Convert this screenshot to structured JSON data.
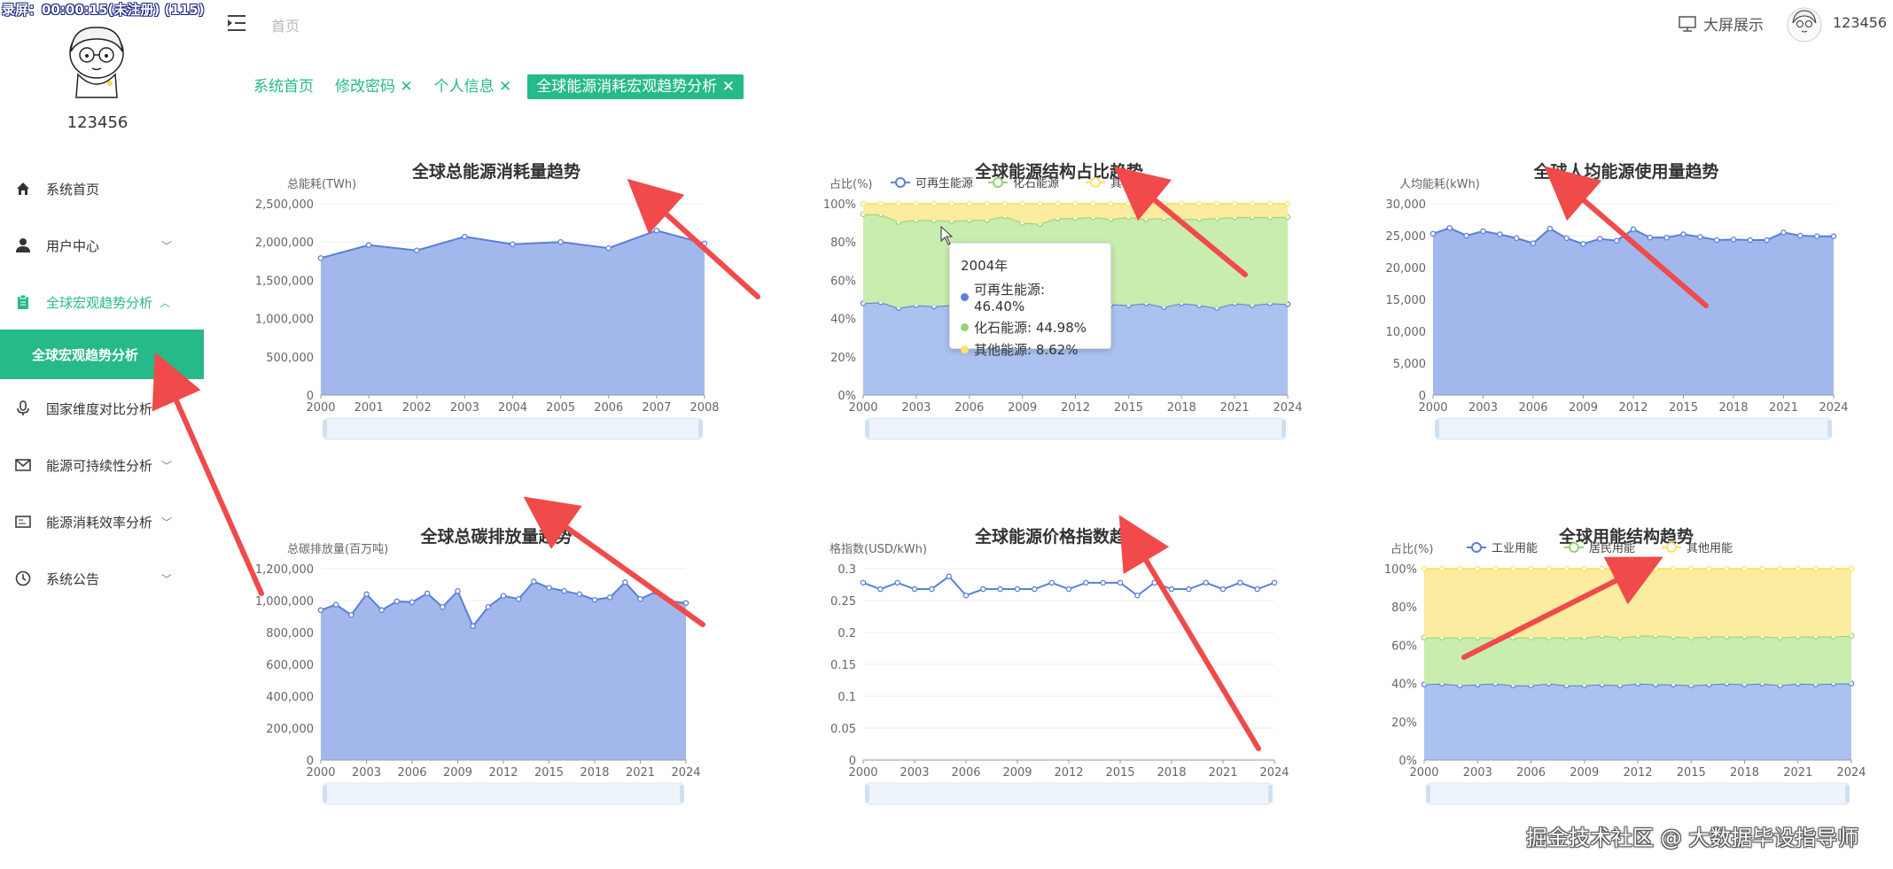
{
  "recording_overlay": "录屏：00:00:15(未注册) (115)",
  "sidebar": {
    "username": "123456",
    "items": [
      {
        "label": "系统首页",
        "icon": "home-icon"
      },
      {
        "label": "用户中心",
        "icon": "user-icon",
        "chevron": "﹀"
      },
      {
        "label": "全球宏观趋势分析",
        "icon": "clipboard-icon",
        "chevron": "︿",
        "open": true
      },
      {
        "label": "国家维度对比分析",
        "icon": "microphone-icon",
        "chevron": "﹀"
      },
      {
        "label": "能源可持续性分析",
        "icon": "mail-icon",
        "chevron": "﹀"
      },
      {
        "label": "能源消耗效率分析",
        "icon": "id-card-icon",
        "chevron": "﹀"
      },
      {
        "label": "系统公告",
        "icon": "clock-icon",
        "chevron": "﹀"
      }
    ],
    "submenu_active": "全球宏观趋势分析"
  },
  "topbar": {
    "breadcrumb": "首页",
    "big_screen_label": "大屏展示",
    "username": "123456"
  },
  "tabs": [
    {
      "label": "系统首页",
      "closable": false,
      "active": false
    },
    {
      "label": "修改密码",
      "closable": true,
      "active": false
    },
    {
      "label": "个人信息",
      "closable": true,
      "active": false
    },
    {
      "label": "全球能源消耗宏观趋势分析",
      "closable": true,
      "active": true
    }
  ],
  "colors": {
    "accent": "#26b98a",
    "blue": "#5b7fd8",
    "blue_fill": "#9db4ec",
    "green": "#95d475",
    "green_fill": "#c6ecaa",
    "yellow": "#fce36b",
    "yellow_fill": "#fbeb9a",
    "arrow": "#f04a4a"
  },
  "tooltip": {
    "title": "2004年",
    "rows": [
      {
        "label": "可再生能源: 46.40%",
        "color": "#5b7fd8"
      },
      {
        "label": "化石能源: 44.98%",
        "color": "#95d475"
      },
      {
        "label": "其他能源: 8.62%",
        "color": "#fce36b"
      }
    ]
  },
  "watermark": "掘金技术社区 @ 大数据毕设指导师",
  "chart_data": [
    {
      "id": "total",
      "type": "area",
      "title": "全球总能源消耗量趋势",
      "ylabel": "总能耗(TWh)",
      "ylim": [
        0,
        2500000
      ],
      "yticks": [
        "0",
        "500,000",
        "1,000,000",
        "1,500,000",
        "2,000,000",
        "2,500,000"
      ],
      "x": [
        2000,
        2001,
        2002,
        2003,
        2004,
        2005,
        2006,
        2007,
        2008
      ],
      "xticks": [
        "2000",
        "2001",
        "2002",
        "2003",
        "2004",
        "2005",
        "2006",
        "2007",
        "2008"
      ],
      "series": [
        {
          "values": [
            1790000,
            1960000,
            1890000,
            2070000,
            1970000,
            2000000,
            1920000,
            2150000,
            1980000
          ]
        }
      ]
    },
    {
      "id": "structure",
      "type": "area",
      "stacked": true,
      "title": "全球能源结构占比趋势",
      "ylabel": "占比(%)",
      "ylim": [
        0,
        100
      ],
      "yticks": [
        "0%",
        "20%",
        "40%",
        "60%",
        "80%",
        "100%"
      ],
      "legend": [
        "可再生能源",
        "化石能源",
        "其他能源"
      ],
      "x": [
        2000,
        2001,
        2002,
        2003,
        2004,
        2005,
        2006,
        2007,
        2008,
        2009,
        2010,
        2011,
        2012,
        2013,
        2014,
        2015,
        2016,
        2017,
        2018,
        2019,
        2020,
        2021,
        2022,
        2023,
        2024
      ],
      "xticks": [
        "2000",
        "2003",
        "2006",
        "2009",
        "2012",
        "2015",
        "2018",
        "2021",
        "2024"
      ],
      "series": [
        {
          "name": "可再生能源",
          "values": [
            48,
            48.5,
            45.5,
            47,
            46.4,
            47,
            45,
            47,
            46.5,
            48,
            45,
            47,
            46,
            48,
            47.5,
            47,
            48,
            46,
            48,
            47,
            45.5,
            48,
            47,
            48,
            47.5
          ]
        },
        {
          "name": "化石能源",
          "values": [
            46.5,
            46,
            45,
            44.5,
            44.98,
            44,
            46.5,
            44.5,
            47,
            42,
            44.5,
            45.5,
            46.5,
            45,
            44.5,
            46,
            44,
            46.5,
            44,
            45,
            47,
            45,
            46,
            45,
            45.5
          ]
        },
        {
          "name": "其他能源",
          "values": [
            5.5,
            5.5,
            9.5,
            8.5,
            8.62,
            9,
            8.5,
            8.5,
            6.5,
            10,
            10.5,
            7.5,
            7.5,
            7,
            8,
            7,
            8,
            7.5,
            8,
            8,
            7.5,
            7,
            7,
            7,
            7
          ]
        }
      ]
    },
    {
      "id": "percapita",
      "type": "area",
      "title": "全球人均能源使用量趋势",
      "ylabel": "人均能耗(kWh)",
      "ylim": [
        0,
        30000
      ],
      "yticks": [
        "0",
        "5,000",
        "10,000",
        "15,000",
        "20,000",
        "25,000",
        "30,000"
      ],
      "x": [
        2000,
        2001,
        2002,
        2003,
        2004,
        2005,
        2006,
        2007,
        2008,
        2009,
        2010,
        2011,
        2012,
        2013,
        2014,
        2015,
        2016,
        2017,
        2018,
        2019,
        2020,
        2021,
        2022,
        2023,
        2024
      ],
      "xticks": [
        "2000",
        "2003",
        "2006",
        "2009",
        "2012",
        "2015",
        "2018",
        "2021",
        "2024"
      ],
      "series": [
        {
          "values": [
            25300,
            26200,
            25000,
            25700,
            25200,
            24600,
            23800,
            26100,
            24600,
            23700,
            24500,
            24200,
            26000,
            24700,
            24700,
            25200,
            24800,
            24300,
            24400,
            24300,
            24300,
            25500,
            25000,
            24900,
            24900
          ]
        }
      ]
    },
    {
      "id": "carbon",
      "type": "area",
      "title": "全球总碳排放量趋势",
      "ylabel": "总碳排放量(百万吨)",
      "ylim": [
        0,
        1200000
      ],
      "yticks": [
        "0",
        "200,000",
        "400,000",
        "600,000",
        "800,000",
        "1,000,000",
        "1,200,000"
      ],
      "x": [
        2000,
        2001,
        2002,
        2003,
        2004,
        2005,
        2006,
        2007,
        2008,
        2009,
        2010,
        2011,
        2012,
        2013,
        2014,
        2015,
        2016,
        2017,
        2018,
        2019,
        2020,
        2021,
        2022,
        2023,
        2024
      ],
      "xticks": [
        "2000",
        "2003",
        "2006",
        "2009",
        "2012",
        "2015",
        "2018",
        "2021",
        "2024"
      ],
      "series": [
        {
          "values": [
            940000,
            975000,
            910000,
            1040000,
            940000,
            995000,
            990000,
            1045000,
            960000,
            1060000,
            840000,
            960000,
            1030000,
            1010000,
            1120000,
            1080000,
            1060000,
            1040000,
            1005000,
            1020000,
            1115000,
            1010000,
            1055000,
            995000,
            985000
          ]
        }
      ]
    },
    {
      "id": "price",
      "type": "line",
      "title": "全球能源价格指数趋势",
      "ylabel": "格指数(USD/kWh)",
      "ylim": [
        0,
        0.3
      ],
      "yticks": [
        "0",
        "0.05",
        "0.1",
        "0.15",
        "0.2",
        "0.25",
        "0.3"
      ],
      "x": [
        2000,
        2001,
        2002,
        2003,
        2004,
        2005,
        2006,
        2007,
        2008,
        2009,
        2010,
        2011,
        2012,
        2013,
        2014,
        2015,
        2016,
        2017,
        2018,
        2019,
        2020,
        2021,
        2022,
        2023,
        2024
      ],
      "xticks": [
        "2000",
        "2003",
        "2006",
        "2009",
        "2012",
        "2015",
        "2018",
        "2021",
        "2024"
      ],
      "series": [
        {
          "values": [
            0.278,
            0.268,
            0.278,
            0.268,
            0.268,
            0.288,
            0.258,
            0.268,
            0.268,
            0.268,
            0.268,
            0.278,
            0.268,
            0.278,
            0.278,
            0.278,
            0.258,
            0.278,
            0.268,
            0.268,
            0.278,
            0.268,
            0.278,
            0.268,
            0.278
          ]
        }
      ]
    },
    {
      "id": "usage",
      "type": "area",
      "stacked": true,
      "title": "全球用能结构趋势",
      "ylabel": "占比(%)",
      "ylim": [
        0,
        100
      ],
      "yticks": [
        "0%",
        "20%",
        "40%",
        "60%",
        "80%",
        "100%"
      ],
      "legend": [
        "工业用能",
        "居民用能",
        "其他用能"
      ],
      "x": [
        2000,
        2001,
        2002,
        2003,
        2004,
        2005,
        2006,
        2007,
        2008,
        2009,
        2010,
        2011,
        2012,
        2013,
        2014,
        2015,
        2016,
        2017,
        2018,
        2019,
        2020,
        2021,
        2022,
        2023,
        2024
      ],
      "xticks": [
        "2000",
        "2003",
        "2006",
        "2009",
        "2012",
        "2015",
        "2018",
        "2021",
        "2024"
      ],
      "series": [
        {
          "name": "工业用能",
          "values": [
            39.5,
            40,
            39,
            39.5,
            40,
            39,
            39,
            40,
            39,
            39,
            39.5,
            39,
            40,
            39.5,
            39.5,
            39,
            39.5,
            40,
            39.5,
            40,
            39,
            40,
            39.5,
            40,
            40
          ]
        },
        {
          "name": "居民用能",
          "values": [
            24.5,
            24,
            25,
            24.5,
            24,
            25,
            25,
            24,
            25,
            25,
            25.5,
            25,
            25,
            25.5,
            25,
            25,
            25,
            24.5,
            25,
            24.5,
            25,
            24.5,
            25,
            24.5,
            25
          ]
        },
        {
          "name": "其他用能",
          "values": [
            36,
            36,
            36,
            36,
            36,
            36,
            36,
            36,
            36,
            36,
            35,
            36,
            35,
            35,
            35.5,
            36,
            35.5,
            35.5,
            35.5,
            35.5,
            36,
            35.5,
            35.5,
            35.5,
            35
          ]
        }
      ]
    }
  ]
}
